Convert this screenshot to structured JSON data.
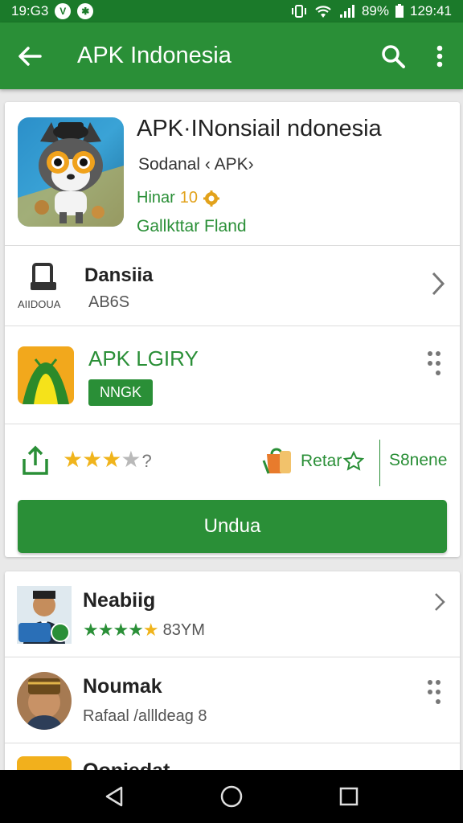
{
  "statusbar": {
    "time_left": "19:G3",
    "icons_left": [
      "vpn-icon",
      "app-notification-icon"
    ],
    "battery": "89%",
    "time_right": "129:41"
  },
  "appbar": {
    "title": "APK Indonesia",
    "icons": [
      "back-arrow-icon",
      "search-icon",
      "more-vert-icon"
    ]
  },
  "app": {
    "title": "APK·INonsiail ndonesia",
    "developer": "Sodanal ‹ APK›",
    "line1_label": "Hinar",
    "line1_value": "10",
    "line2": "Gallkttar Fland"
  },
  "device_row": {
    "icon_caption": "AIIDOUA",
    "name": "Dansiia",
    "sub": "AB6S"
  },
  "brand_row": {
    "name": "APK LGIRY",
    "badge": "NNGK"
  },
  "actions": {
    "rating_filled": 3,
    "rating_total": 4,
    "rating_suffix": "?",
    "rate_label": "Retar",
    "share_label": "S8nene"
  },
  "cta": {
    "label": "Undua"
  },
  "list": [
    {
      "name": "Neabiig",
      "sub": "83YM",
      "stars": "★★★★"
    },
    {
      "name": "Noumak",
      "sub": "Rafaal /allldeag 8"
    },
    {
      "name": "Ooniedat"
    }
  ],
  "navbar": {
    "icons": [
      "back-triangle-icon",
      "home-circle-icon",
      "recents-square-icon"
    ]
  },
  "colors": {
    "primary": "#2a8f37",
    "statusbar": "#1b7a2a",
    "star": "#f0b41c"
  }
}
